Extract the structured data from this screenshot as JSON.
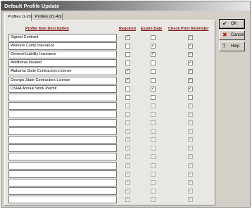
{
  "window": {
    "title": "Default Profile Update"
  },
  "tabs": [
    {
      "label": "Profiles (1-20)",
      "active": true
    },
    {
      "label": "Profiles (21-40)",
      "active": false
    }
  ],
  "columns": {
    "description": "Profile Item Description",
    "required": "Required",
    "expire_date": "Expire Date",
    "check_print": "Check Print Reminder"
  },
  "rows": [
    {
      "description": "Signed Contract",
      "required": true,
      "expire_date": false,
      "check_print": true,
      "enabled": true
    },
    {
      "description": "Workers Comp Insurance",
      "required": false,
      "expire_date": true,
      "check_print": true,
      "enabled": true
    },
    {
      "description": "General Liability Insurance",
      "required": false,
      "expire_date": true,
      "check_print": true,
      "enabled": true
    },
    {
      "description": "  Additional Insured",
      "required": false,
      "expire_date": false,
      "check_print": true,
      "enabled": true
    },
    {
      "description": "Alabama State Contractors License",
      "required": true,
      "expire_date": false,
      "check_print": true,
      "enabled": true
    },
    {
      "description": "Georgia State Contractors License",
      "required": true,
      "expire_date": false,
      "check_print": true,
      "enabled": true
    },
    {
      "description": "OSHA Annual Work Permit",
      "required": false,
      "expire_date": true,
      "check_print": true,
      "enabled": true
    },
    {
      "description": "",
      "required": false,
      "expire_date": false,
      "check_print": false,
      "enabled": true
    },
    {
      "description": "",
      "required": false,
      "expire_date": false,
      "check_print": true,
      "enabled": false
    },
    {
      "description": "",
      "required": false,
      "expire_date": false,
      "check_print": true,
      "enabled": false
    },
    {
      "description": "",
      "required": false,
      "expire_date": false,
      "check_print": true,
      "enabled": false
    },
    {
      "description": "",
      "required": true,
      "expire_date": false,
      "check_print": true,
      "enabled": false
    },
    {
      "description": "",
      "required": true,
      "expire_date": false,
      "check_print": true,
      "enabled": false
    },
    {
      "description": "",
      "required": true,
      "expire_date": false,
      "check_print": true,
      "enabled": false
    },
    {
      "description": "",
      "required": true,
      "expire_date": false,
      "check_print": true,
      "enabled": false
    },
    {
      "description": "",
      "required": true,
      "expire_date": false,
      "check_print": true,
      "enabled": false
    },
    {
      "description": "",
      "required": true,
      "expire_date": false,
      "check_print": true,
      "enabled": false
    },
    {
      "description": "",
      "required": true,
      "expire_date": false,
      "check_print": true,
      "enabled": false
    },
    {
      "description": "",
      "required": true,
      "expire_date": false,
      "check_print": true,
      "enabled": false
    },
    {
      "description": "",
      "required": true,
      "expire_date": false,
      "check_print": true,
      "enabled": false
    }
  ],
  "buttons": {
    "ok": {
      "label": "OK",
      "icon": "checkmark-icon"
    },
    "cancel": {
      "label": "Cancel",
      "icon": "cancel-icon"
    },
    "help": {
      "label": "Help",
      "icon": "help-icon"
    }
  },
  "check_glyph": "✓"
}
